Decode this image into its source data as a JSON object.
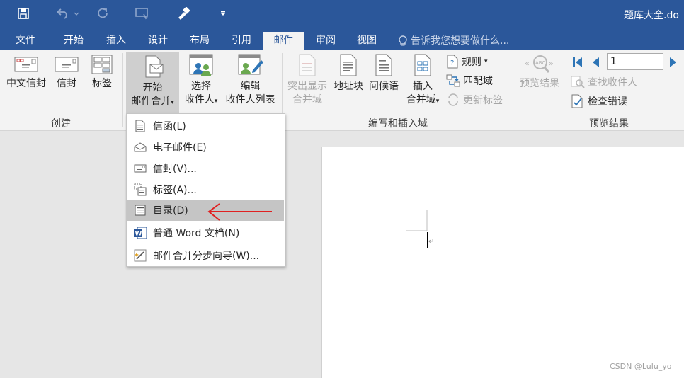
{
  "title_bar": {
    "document_title": "题库大全.do",
    "qat_icons": [
      "save-icon",
      "undo-icon",
      "redo-icon",
      "touch-mode-icon",
      "format-painter-icon",
      "customize-qat-icon"
    ]
  },
  "tabs": [
    "文件",
    "开始",
    "插入",
    "设计",
    "布局",
    "引用",
    "邮件",
    "审阅",
    "视图"
  ],
  "tell_me": "告诉我您想要做什么...",
  "ribbon": {
    "create": {
      "label": "创建",
      "chinese_envelope": "中文信封",
      "envelope": "信封",
      "labels": "标签"
    },
    "start_merge": {
      "start_line1": "开始",
      "start_line2": "邮件合并",
      "select_line1": "选择",
      "select_line2": "收件人",
      "edit_line1": "编辑",
      "edit_line2": "收件人列表"
    },
    "write_insert": {
      "label": "编写和插入域",
      "highlight_line1": "突出显示",
      "highlight_line2": "合并域",
      "address_block": "地址块",
      "greeting": "问候语",
      "insert_line1": "插入",
      "insert_line2": "合并域",
      "rules": "规则",
      "match_fields": "匹配域",
      "update_labels": "更新标签"
    },
    "preview": {
      "label": "预览结果",
      "preview_results": "预览结果",
      "record_number": "1",
      "find_recipient": "查找收件人",
      "check_errors": "检查错误"
    }
  },
  "menu": {
    "items": [
      "信函(L)",
      "电子邮件(E)",
      "信封(V)...",
      "标签(A)...",
      "目录(D)",
      "普通 Word 文档(N)",
      "邮件合并分步向导(W)..."
    ],
    "highlighted_index": 4
  },
  "watermark": "CSDN @Lulu_yo",
  "colors": {
    "ribbon_blue": "#2b579a",
    "arrow_red": "#e02020"
  }
}
